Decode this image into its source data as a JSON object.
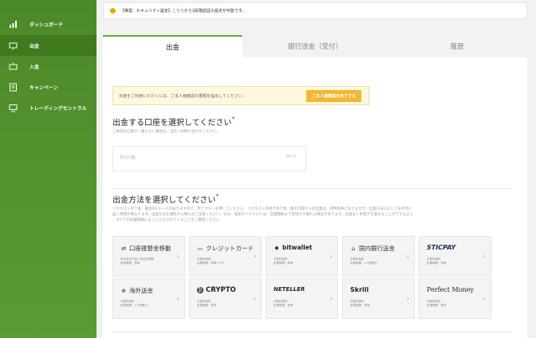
{
  "sidebar": {
    "items": [
      {
        "label": "ダッシュボード",
        "icon": "chart-icon"
      },
      {
        "label": "出金",
        "icon": "withdraw-icon"
      },
      {
        "label": "入金",
        "icon": "deposit-icon"
      },
      {
        "label": "キャンペーン",
        "icon": "campaign-icon"
      },
      {
        "label": "トレーディングセントラル",
        "icon": "monitor-icon"
      }
    ]
  },
  "notice": {
    "prefix": "【推奨：セキュリティ設定】",
    "link": "こちら",
    "suffix": "から2段階認証の設定が可能です。"
  },
  "tabs": [
    "出金",
    "銀行送金（受付）",
    "履歴"
  ],
  "kyc": {
    "text": "出金をご利用いただくには、ご本人様確認の書類を提出してください。",
    "button": "ご本人様確認を完了する"
  },
  "account_section": {
    "title": "出金する口座を選択してください",
    "required": "*",
    "note": "ご希望の口座が一覧にない場合は、当社へお問い合わせください。",
    "account_label": "取引口座",
    "currency": "JPY 0"
  },
  "method_section": {
    "title": "出金方法を選択してください",
    "required": "*",
    "note1": "リクエスト完了後、確認のEメールが届きますので、完了ボタンを押してください。リクエスト手続き完了後、取引口座からの出金は、即時反映となりますが、出金方法に応じてお手元に",
    "note2": "届く時間が異なります。出金方法を選択する際にはご注意ください。なお、週末のリクエストは、営業開始まで手続きが遅れる場合があります。迅速なく手続きを進めることができるよう",
    "note3": "、すべての記載情報に正しく入力されていることをご確認ください"
  },
  "methods": [
    {
      "name": "口座振替金移動",
      "icon": "transfer-icon",
      "d1": "他の取引口座へ資金を移動",
      "d2": "処理時間：即時"
    },
    {
      "name": "クレジットカード",
      "icon": "card-icon",
      "d1": "手数料無料",
      "d2": "処理時間：即時〜1日"
    },
    {
      "name": "bitwallet",
      "icon": "bitwallet-icon",
      "d1": "手数料無料",
      "d2": "処理時間：即時"
    },
    {
      "name": "国内銀行送金",
      "icon": "bank-icon",
      "d1": "手数料無料",
      "d2": "処理時間：1-3営業日"
    },
    {
      "name": "STICPAY",
      "icon": "sticpay-logo",
      "d1": "手数料無料",
      "d2": "処理時間：即時"
    },
    {
      "name": "海外送金",
      "icon": "globe-icon",
      "d1": "手数料無料",
      "d2": "処理時間：2-5営業日"
    },
    {
      "name": "CRYPTO",
      "icon": "bitcoin-icon",
      "d1": "手数料無料",
      "d2": "処理時間：即時"
    },
    {
      "name": "NETELLER",
      "icon": "neteller-logo",
      "d1": "手数料無料",
      "d2": "処理時間：即時"
    },
    {
      "name": "Skrill",
      "icon": "skrill-logo",
      "d1": "手数料無料",
      "d2": "処理時間：即時"
    },
    {
      "name": "Perfect Money",
      "icon": "perfect-money-logo",
      "d1": "手数料無料",
      "d2": "処理時間：即時"
    }
  ],
  "colors": {
    "sidebar": "#4c8a28",
    "accent": "#5cb030",
    "kyc_button": "#f2b830",
    "link": "#1a6fd6"
  }
}
